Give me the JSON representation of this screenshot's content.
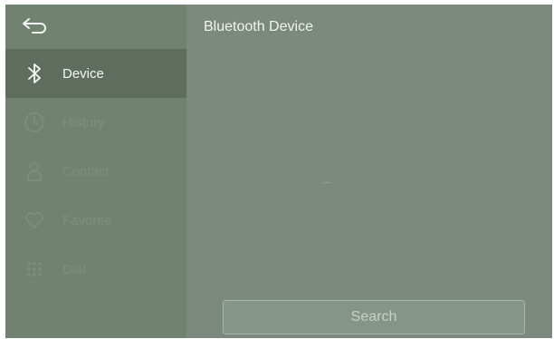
{
  "header": {
    "title": "Bluetooth Device",
    "back_icon": "back-arrow-icon"
  },
  "sidebar": {
    "items": [
      {
        "label": "Device",
        "icon": "bluetooth-icon",
        "active": true
      },
      {
        "label": "History",
        "icon": "clock-icon",
        "active": false
      },
      {
        "label": "Contact",
        "icon": "person-icon",
        "active": false
      },
      {
        "label": "Favorite",
        "icon": "heart-icon",
        "active": false
      },
      {
        "label": "Dial",
        "icon": "dialpad-icon",
        "active": false
      }
    ]
  },
  "main": {
    "search_label": "Search"
  },
  "colors": {
    "screen_background": "#7b8a7c",
    "sidebar_background": "#728271",
    "active_item_background": "#5f6d5f",
    "active_text": "#f3f6f3",
    "inactive_text": "#7f8e80",
    "search_border": "#a9b5aa"
  }
}
